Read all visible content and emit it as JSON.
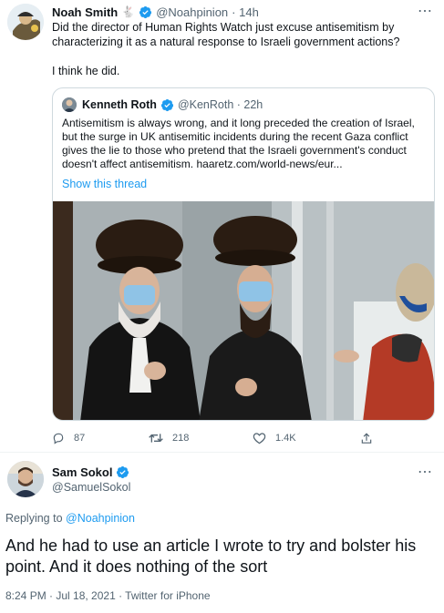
{
  "top_tweet": {
    "author_name": "Noah Smith",
    "author_emoji": "🐇",
    "handle": "@Noahpinion",
    "time": "· 14h",
    "text": "Did the director of Human Rights Watch just excuse antisemitism by characterizing it as a natural response to Israeli government actions?",
    "text2": "I think he did.",
    "more_icon": "⋯",
    "quote": {
      "author_name": "Kenneth Roth",
      "handle": "@KenRoth · 22h",
      "text": "Antisemitism is always wrong, and it long preceded the creation of Israel, but the surge in UK antisemitic incidents during the recent Gaza conflict gives the lie to those who pretend that the Israeli government's conduct doesn't affect antisemitism. haaretz.com/world-news/eur...",
      "show_thread": "Show this thread"
    },
    "actions": {
      "replies": "87",
      "retweets": "218",
      "likes": "1.4K"
    }
  },
  "main_tweet": {
    "author_name": "Sam Sokol",
    "handle": "@SamuelSokol",
    "more_icon": "⋯",
    "replying_prefix": "Replying to",
    "replying_handle": "@Noahpinion",
    "text": "And he had to use an article I wrote to try and bolster his point. And it does nothing of the sort",
    "meta": "8:24 PM · Jul 18, 2021 · Twitter for iPhone"
  },
  "colors": {
    "accent": "#1d9bf0",
    "secondary_text": "#536471",
    "border": "#cfd9de"
  }
}
